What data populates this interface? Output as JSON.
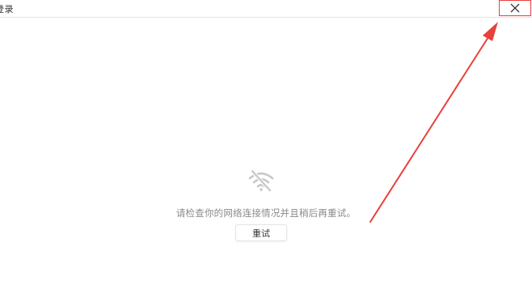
{
  "window": {
    "title": "登录"
  },
  "icons": {
    "close": "close-icon",
    "wifi": "wifi-off-icon"
  },
  "main": {
    "message": "请检查你的网络连接情况并且稍后再重试。",
    "retry_label": "重试"
  },
  "colors": {
    "annotation": "#e8403b",
    "message_text": "#8a8a8a",
    "icon": "#c8c8c8"
  }
}
